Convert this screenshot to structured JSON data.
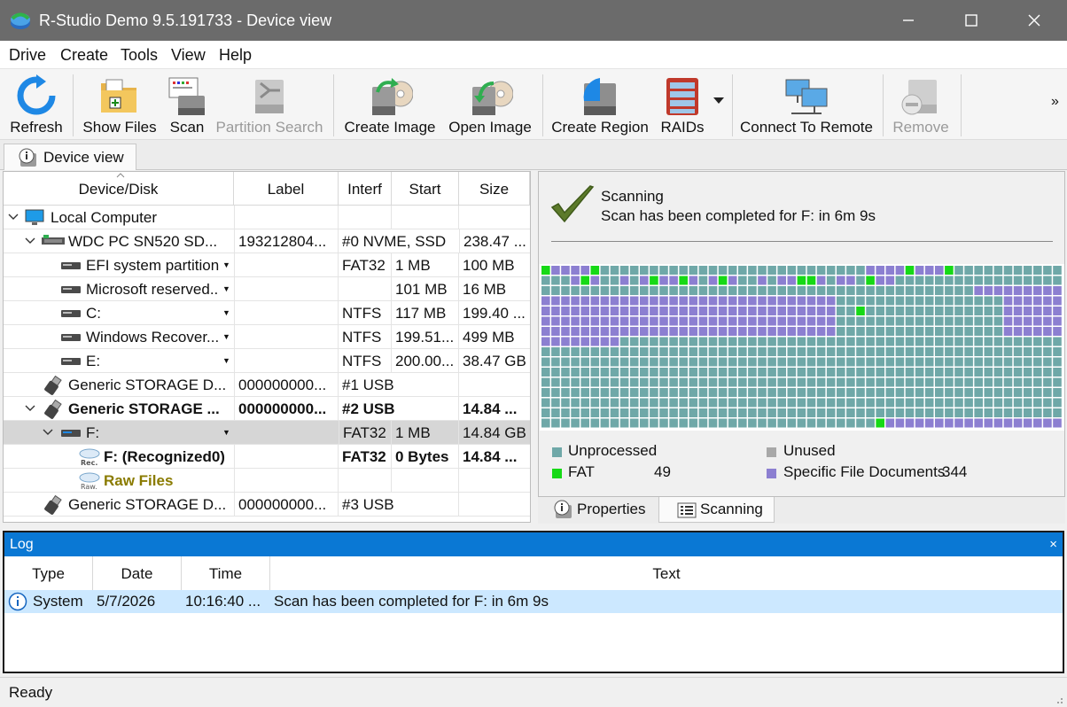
{
  "window": {
    "title": "R-Studio Demo 9.5.191733 - Device view"
  },
  "menu": [
    "Drive",
    "Create",
    "Tools",
    "View",
    "Help"
  ],
  "toolbar": {
    "refresh": "Refresh",
    "show_files": "Show Files",
    "scan": "Scan",
    "partition_search": "Partition Search",
    "create_image": "Create Image",
    "open_image": "Open Image",
    "create_region": "Create Region",
    "raids": "RAIDs",
    "connect_to_remote": "Connect To Remote",
    "remove": "Remove",
    "overflow": "»"
  },
  "tabs": {
    "device_view": "Device view"
  },
  "tree": {
    "columns": [
      "Device/Disk",
      "Label",
      "Interf",
      "Start",
      "Size"
    ],
    "rows": [
      {
        "name": "Local Computer",
        "label": "",
        "interface": "",
        "start": "",
        "size": ""
      },
      {
        "name": "WDC PC SN520 SD...",
        "label": "193212804...",
        "interface": "#0 NVME, SSD",
        "start": "",
        "size": "238.47 ..."
      },
      {
        "name": "EFI system partition",
        "label": "",
        "interface": "FAT32",
        "start": "1 MB",
        "size": "100 MB"
      },
      {
        "name": "Microsoft reserved...",
        "label": "",
        "interface": "",
        "start": "101 MB",
        "size": "16 MB"
      },
      {
        "name": "C:",
        "label": "",
        "interface": "NTFS",
        "start": "117 MB",
        "size": "199.40 ..."
      },
      {
        "name": "Windows Recover...",
        "label": "",
        "interface": "NTFS",
        "start": "199.51...",
        "size": "499 MB"
      },
      {
        "name": "E:",
        "label": "",
        "interface": "NTFS",
        "start": "200.00...",
        "size": "38.47 GB"
      },
      {
        "name": "Generic STORAGE D...",
        "label": "000000000...",
        "interface": "#1 USB",
        "start": "",
        "size": ""
      },
      {
        "name": "Generic STORAGE ...",
        "label": "000000000...",
        "interface": "#2 USB",
        "start": "",
        "size": "14.84 ..."
      },
      {
        "name": "F:",
        "label": "",
        "interface": "FAT32",
        "start": "1 MB",
        "size": "14.84 GB"
      },
      {
        "name": "F: (Recognized0)",
        "label": "",
        "interface": "FAT32",
        "start": "0 Bytes",
        "size": "14.84 ..."
      },
      {
        "name": "Raw Files",
        "label": "",
        "interface": "",
        "start": "",
        "size": ""
      },
      {
        "name": "Generic STORAGE D...",
        "label": "000000000...",
        "interface": "#3 USB",
        "start": "",
        "size": ""
      }
    ]
  },
  "scan": {
    "title": "Scanning",
    "message": "Scan has been completed for F: in 6m 9s",
    "legend": {
      "unprocessed": "Unprocessed",
      "unused": "Unused",
      "fat": "FAT",
      "fat_count": "49",
      "specific_docs": "Specific File Documents",
      "specific_docs_count": "344"
    },
    "colors": {
      "unprocessed": "#6fa8a8",
      "fat": "#16d916",
      "specific": "#8c7fd1",
      "unused": "#a8a8a8"
    }
  },
  "right_tabs": {
    "properties": "Properties",
    "scanning": "Scanning"
  },
  "log": {
    "title": "Log",
    "close": "×",
    "columns": [
      "Type",
      "Date",
      "Time",
      "Text"
    ],
    "rows": [
      {
        "type": "System",
        "date": "5/7/2026",
        "time": "10:16:40 ...",
        "text": "Scan has been completed for F: in 6m 9s"
      }
    ]
  },
  "status": "Ready"
}
